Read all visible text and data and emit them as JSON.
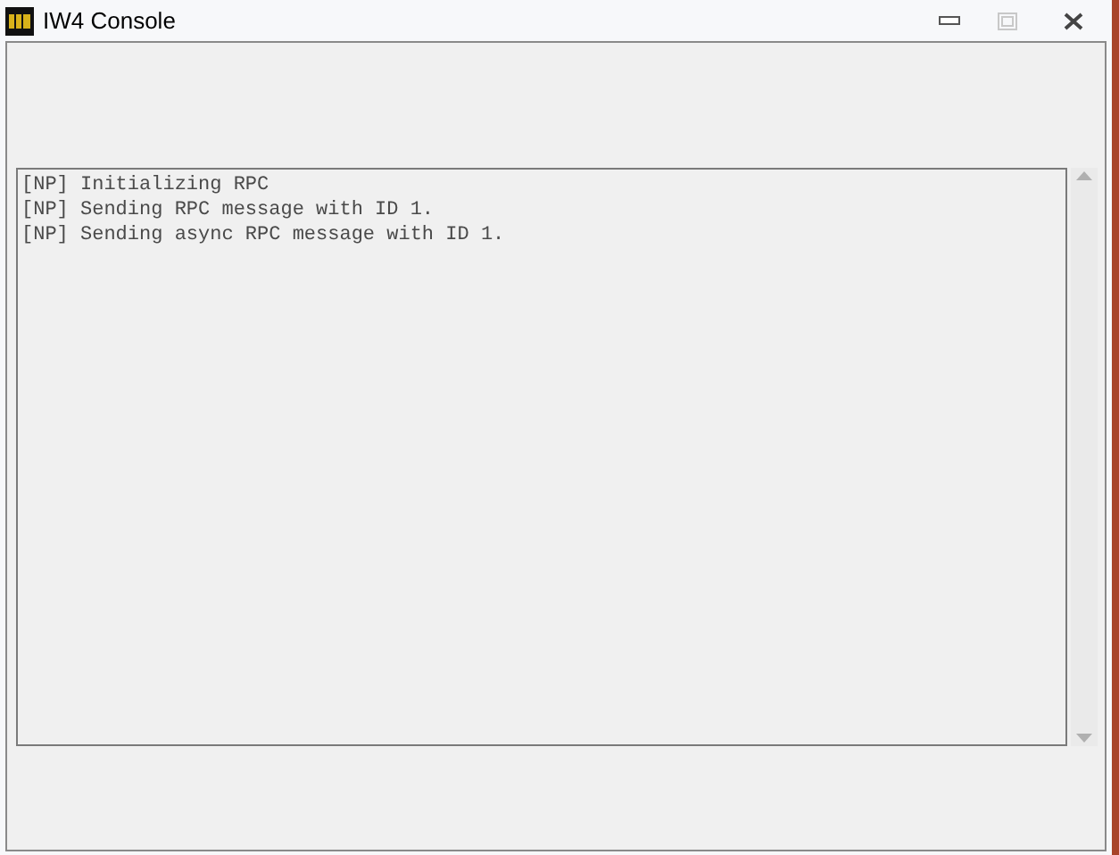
{
  "window": {
    "title": "IW4 Console",
    "maximize_disabled": true
  },
  "log": {
    "lines": [
      "[NP] Initializing RPC",
      "[NP] Sending RPC message with ID 1.",
      "[NP] Sending async RPC message with ID 1."
    ]
  }
}
